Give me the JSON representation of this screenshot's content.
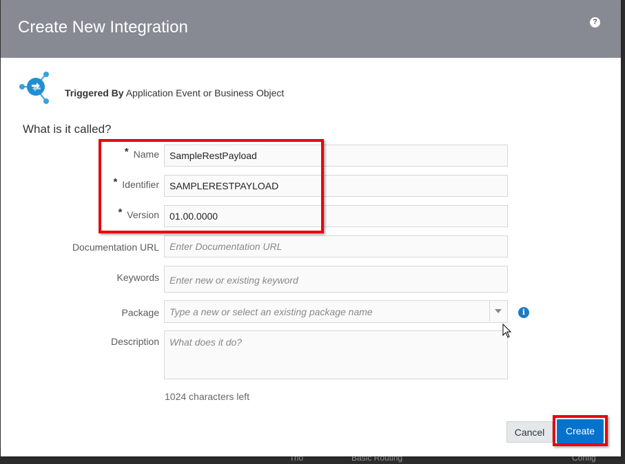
{
  "dialog": {
    "title": "Create New Integration",
    "help_icon": "?",
    "trigger": {
      "label": "Triggered By",
      "value": "Application Event or Business Object",
      "icon": "integration-trigger-icon"
    },
    "section_title": "What is it called?"
  },
  "form": {
    "name": {
      "label": "Name",
      "required": "*",
      "value": "SampleRestPayload"
    },
    "identifier": {
      "label": "Identifier",
      "required": "*",
      "value": "SAMPLERESTPAYLOAD"
    },
    "version": {
      "label": "Version",
      "required": "*",
      "value": "01.00.0000"
    },
    "documentation_url": {
      "label": "Documentation URL",
      "placeholder": "Enter Documentation URL"
    },
    "keywords": {
      "label": "Keywords",
      "placeholder": "Enter new or existing keyword"
    },
    "package": {
      "label": "Package",
      "placeholder": "Type a new or select an existing package name",
      "info_icon": "i"
    },
    "description": {
      "label": "Description",
      "placeholder": "What does it do?"
    },
    "chars_left": "1024 characters left"
  },
  "buttons": {
    "cancel": "Cancel",
    "create": "Create"
  },
  "background": {
    "col1": "Trio",
    "col2": "Basic Routing",
    "col3": "Config"
  },
  "colors": {
    "header": "#888a93",
    "primary": "#0572ce",
    "highlight": "#e8000f"
  }
}
